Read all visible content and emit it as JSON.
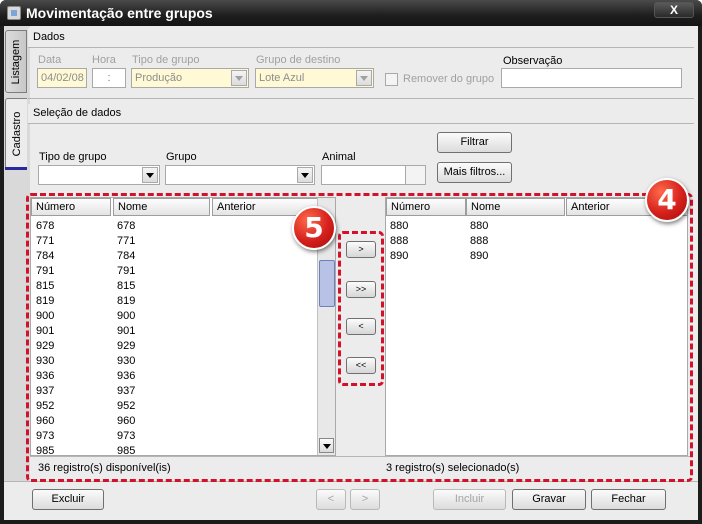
{
  "window": {
    "title": "Movimentação entre grupos",
    "close_label": "X"
  },
  "side_tabs": [
    {
      "label": "Listagem"
    },
    {
      "label": "Cadastro"
    }
  ],
  "dados": {
    "section_label": "Dados",
    "data_label": "Data",
    "data_value": "04/02/08",
    "hora_label": "Hora",
    "hora_value": ":",
    "tipo_grupo_label": "Tipo de grupo",
    "tipo_grupo_value": "Produção",
    "grupo_destino_label": "Grupo de destino",
    "grupo_destino_value": "Lote Azul",
    "remover_label": "Remover do grupo",
    "observacao_label": "Observação",
    "observacao_value": ""
  },
  "selecao": {
    "section_label": "Seleção de dados",
    "tipo_grupo_label": "Tipo de grupo",
    "grupo_label": "Grupo",
    "animal_label": "Animal",
    "filtrar_label": "Filtrar",
    "mais_filtros_label": "Mais filtros..."
  },
  "left_grid": {
    "columns": [
      "Número",
      "Nome",
      "Anterior"
    ],
    "rows": [
      [
        "678",
        "678",
        ""
      ],
      [
        "771",
        "771",
        ""
      ],
      [
        "784",
        "784",
        ""
      ],
      [
        "791",
        "791",
        ""
      ],
      [
        "815",
        "815",
        ""
      ],
      [
        "819",
        "819",
        ""
      ],
      [
        "900",
        "900",
        ""
      ],
      [
        "901",
        "901",
        ""
      ],
      [
        "929",
        "929",
        ""
      ],
      [
        "930",
        "930",
        ""
      ],
      [
        "936",
        "936",
        ""
      ],
      [
        "937",
        "937",
        ""
      ],
      [
        "952",
        "952",
        ""
      ],
      [
        "960",
        "960",
        ""
      ],
      [
        "973",
        "973",
        ""
      ],
      [
        "985",
        "985",
        ""
      ]
    ],
    "status": "36 registro(s) disponível(is)"
  },
  "right_grid": {
    "columns": [
      "Número",
      "Nome",
      "Anterior"
    ],
    "rows": [
      [
        "880",
        "880",
        ""
      ],
      [
        "888",
        "888",
        ""
      ],
      [
        "890",
        "890",
        ""
      ]
    ],
    "status": "3 registro(s) selecionado(s)"
  },
  "transfer_buttons": {
    "move_one": ">",
    "move_all": ">>",
    "back_one": "<",
    "back_all": "<<"
  },
  "footer": {
    "excluir_label": "Excluir",
    "prev_label": "<",
    "next_label": ">",
    "incluir_label": "Incluir",
    "gravar_label": "Gravar",
    "fechar_label": "Fechar"
  },
  "annotations": {
    "badge_4": "4",
    "badge_5": "5"
  },
  "colors": {
    "annotation_red": "#d3112a",
    "title_bar": "#1e1e1e",
    "highlight_field": "#fff9d6"
  }
}
